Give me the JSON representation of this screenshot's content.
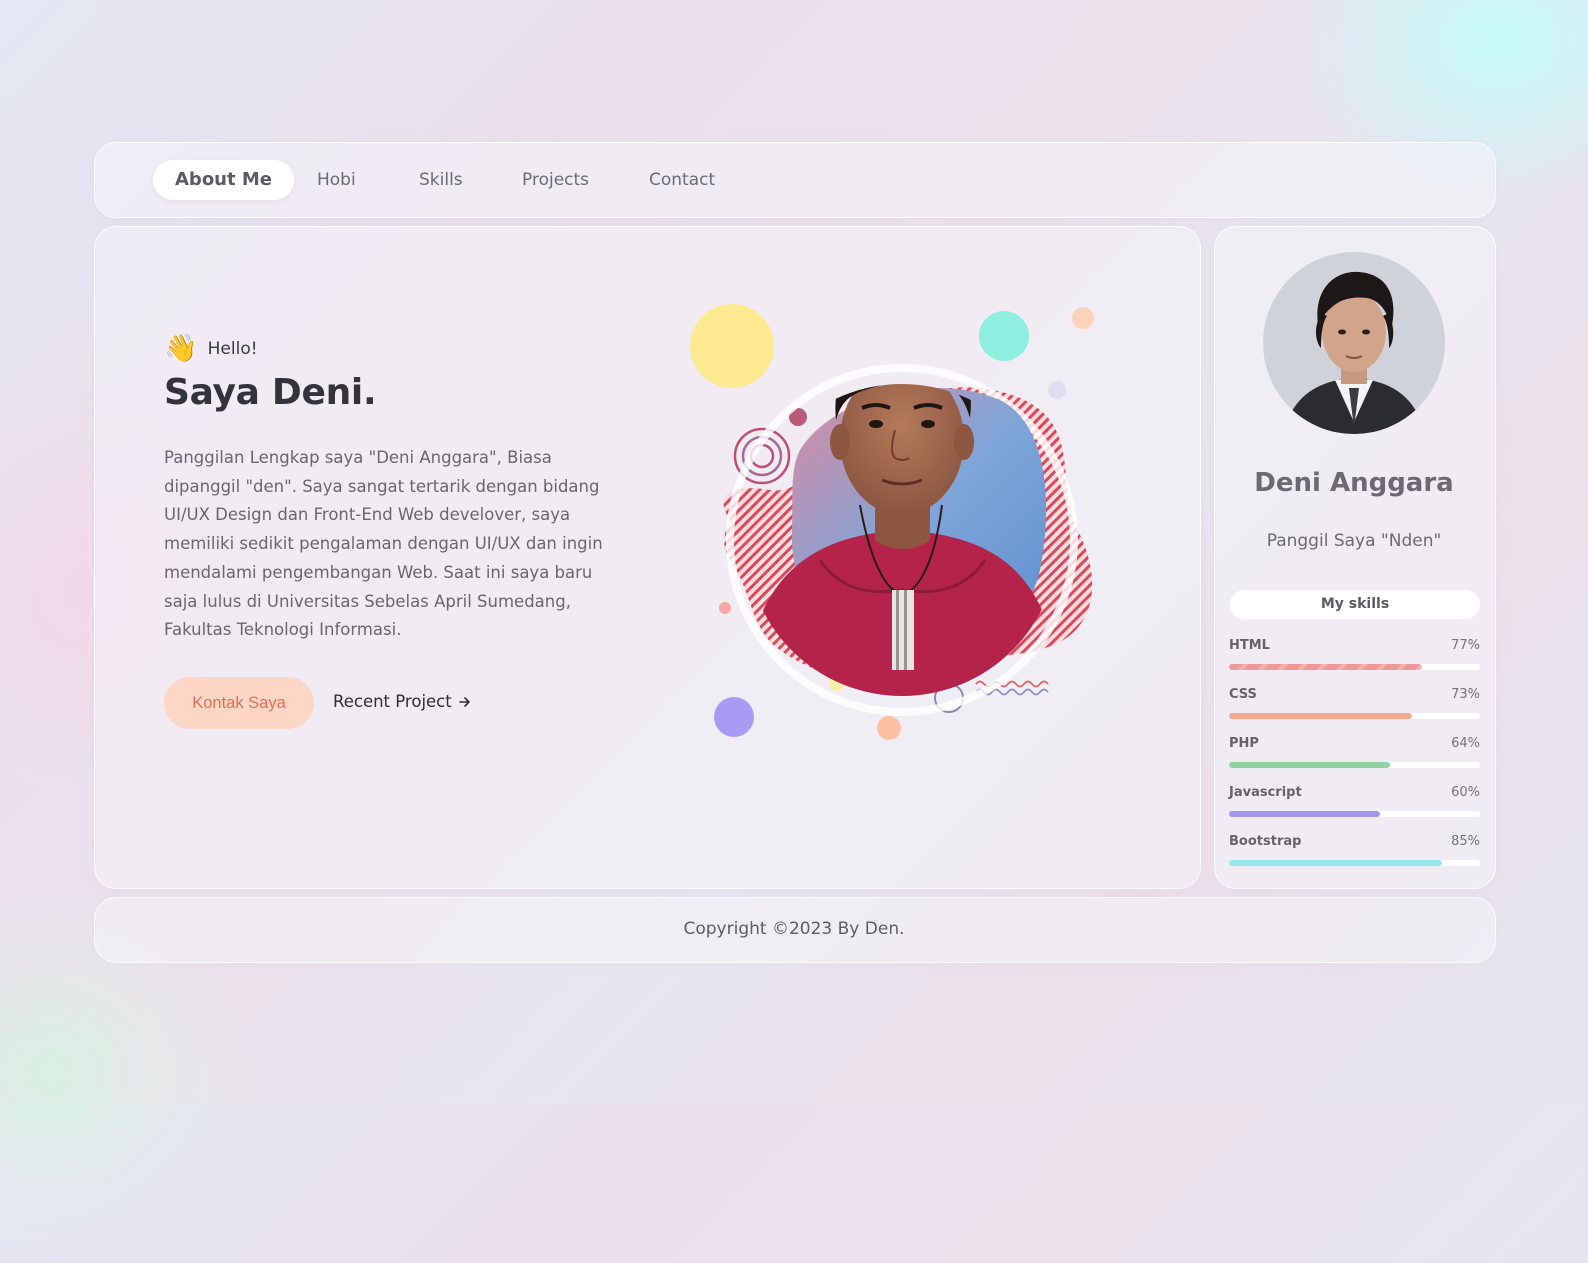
{
  "nav": {
    "items": [
      {
        "label": "About Me",
        "active": true
      },
      {
        "label": "Hobi",
        "active": false
      },
      {
        "label": "Skills",
        "active": false
      },
      {
        "label": "Projects",
        "active": false
      },
      {
        "label": "Contact",
        "active": false
      }
    ]
  },
  "hero": {
    "greeting_icon": "waving-hand-icon",
    "greeting": "Hello!",
    "title": "Saya Deni.",
    "bio": "Panggilan Lengkap saya \"Deni Anggara\", Biasa dipanggil \"den\". Saya sangat tertarik dengan bidang UI/UX Design dan Front-End Web develover, saya memiliki sedikit pengalaman dengan UI/UX dan ingin mendalami pengembangan Web. Saat ini saya baru saja lulus di Universitas Sebelas April Sumedang, Fakultas Teknologi Informasi.",
    "primary_button": "Kontak Saya",
    "secondary_link": "Recent Project",
    "secondary_link_icon": "arrow-right-icon"
  },
  "profile": {
    "name": "Deni Anggara",
    "nickname": "Panggil Saya \"Nden\"",
    "skills_title": "My skills",
    "skills": [
      {
        "name": "HTML",
        "percent_label": "77%",
        "value": 77,
        "color": "#ee9999"
      },
      {
        "name": "CSS",
        "percent_label": "73%",
        "value": 73,
        "color": "#f7a890"
      },
      {
        "name": "PHP",
        "percent_label": "64%",
        "value": 64,
        "color": "#8fd3a0"
      },
      {
        "name": "Javascript",
        "percent_label": "60%",
        "value": 60,
        "color": "#a394ee"
      },
      {
        "name": "Bootstrap",
        "percent_label": "85%",
        "value": 85,
        "color": "#93e8ea"
      }
    ]
  },
  "footer": {
    "copyright": "Copyright ©2023 By Den."
  },
  "colors": {
    "accent_button_bg": "#fdd6c6",
    "accent_button_text": "#e0705e",
    "heading": "#33333d"
  }
}
